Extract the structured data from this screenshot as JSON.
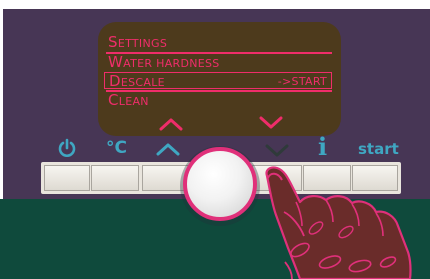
{
  "display": {
    "items": [
      {
        "label_first": "S",
        "label_rest": "ETTINGS"
      },
      {
        "label_first": "W",
        "label_rest": "ATER HARDNESS"
      },
      {
        "label_first": "D",
        "label_rest": "ESCALE",
        "action": "->START"
      },
      {
        "label_first": "C",
        "label_rest": "LEAN"
      }
    ],
    "selected_index": 2
  },
  "buttons": {
    "power_icon": "power-icon",
    "temperature_label": "°C",
    "up_icon": "chevron-up-icon",
    "down_icon": "chevron-down-icon",
    "info_label": "i",
    "start_label": "start"
  },
  "colors": {
    "panel": "#473655",
    "display_bg": "#4d3a1c",
    "display_text": "#ef2d6a",
    "icon": "#3fa7c2",
    "accent": "#e0307a",
    "base": "#0f4a3c"
  }
}
